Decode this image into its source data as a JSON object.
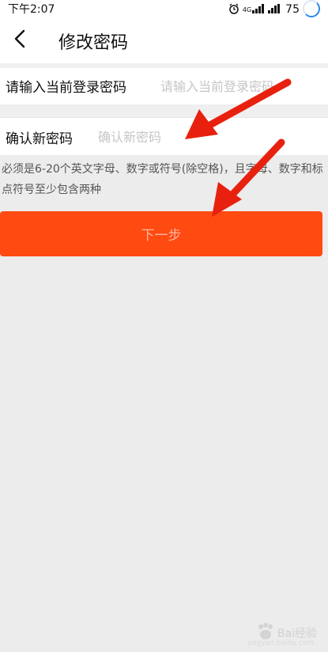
{
  "status_bar": {
    "time": "下午2:07",
    "network_label": "4G",
    "battery": "75"
  },
  "header": {
    "title": "修改密码",
    "back_icon": "chevron-left-icon"
  },
  "form": {
    "current_password": {
      "label": "请输入当前登录密码",
      "placeholder": "请输入当前登录密码",
      "value": ""
    },
    "confirm_password": {
      "label": "确认新密码",
      "placeholder": "确认新密码",
      "value": ""
    },
    "hint": "必须是6-20个英文字母、数字或符号(除空格)，且字母、数字和标点符号至少包含两种",
    "next_button": "下一步"
  },
  "annotations": {
    "arrow_color": "#e8210f"
  },
  "watermark": {
    "text": "Bai经验",
    "sub": "jingyan.baidu.com"
  },
  "colors": {
    "accent": "#ff4a12",
    "background": "#ececec"
  }
}
